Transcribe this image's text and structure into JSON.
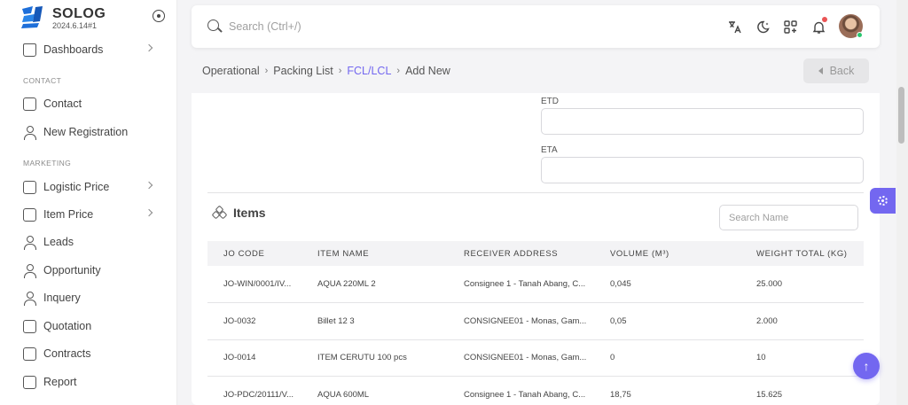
{
  "brand": {
    "name": "SOLOG",
    "version": "2024.6.14#1",
    "logo_text": "SL"
  },
  "sidebar": {
    "dashboards": "Dashboards",
    "section_contact": "CONTACT",
    "contact": "Contact",
    "new_registration": "New Registration",
    "section_marketing": "MARKETING",
    "logistic_price": "Logistic Price",
    "item_price": "Item Price",
    "leads": "Leads",
    "opportunity": "Opportunity",
    "inquery": "Inquery",
    "quotation": "Quotation",
    "contracts": "Contracts",
    "report": "Report"
  },
  "search": {
    "placeholder": "Search (Ctrl+/)"
  },
  "topbar_icons": [
    "translate-icon",
    "moon-icon",
    "grid-plus-icon",
    "bell-icon"
  ],
  "breadcrumb": [
    "Operational",
    "Packing List",
    "FCL/LCL",
    "Add New"
  ],
  "back_label": "Back",
  "form": {
    "etd_label": "ETD",
    "eta_label": "ETA"
  },
  "items": {
    "title": "Items",
    "search_placeholder": "Search Name",
    "columns": [
      "JO CODE",
      "ITEM NAME",
      "RECEIVER ADDRESS",
      "VOLUME (M³)",
      "WEIGHT TOTAL (KG)"
    ],
    "rows": [
      [
        "JO-WIN/0001/IV...",
        "AQUA 220ML 2",
        "Consignee 1 - Tanah Abang, C...",
        "0,045",
        "25.000"
      ],
      [
        "JO-0032",
        "Billet 12 3",
        "CONSIGNEE01 - Monas, Gam...",
        "0,05",
        "2.000"
      ],
      [
        "JO-0014",
        "ITEM CERUTU 100 pcs",
        "CONSIGNEE01 - Monas, Gam...",
        "0",
        "10"
      ],
      [
        "JO-PDC/20111/V...",
        "AQUA 600ML",
        "Consignee 1 - Tanah Abang, C...",
        "18,75",
        "15.625"
      ]
    ]
  },
  "colors": {
    "primary": "#7367f0",
    "brand_blue": "#1e6fd9",
    "notification": "#ea5455",
    "online": "#28c76f"
  }
}
